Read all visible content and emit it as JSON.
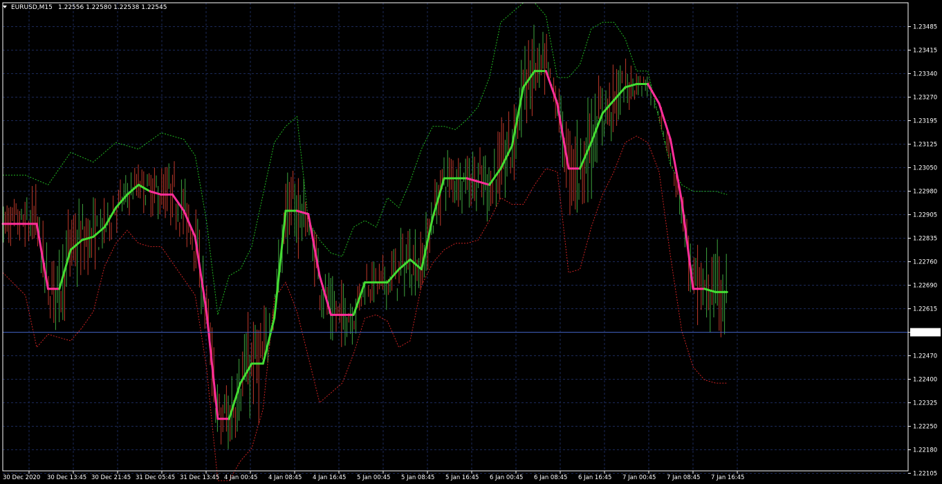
{
  "header": {
    "symbol_timeframe": "EURUSD,M15",
    "ohlc": "1.22556 1.22580 1.22538 1.22545"
  },
  "colors": {
    "background": "#000000",
    "grid": "#1c2a5a",
    "axis": "#ffffff",
    "candle_up": "#3fa63f",
    "candle_down": "#c0392b",
    "trend_up": "#44dd33",
    "trend_down": "#ff2e9a",
    "upper_band": "#22bb22",
    "lower_band": "#cc2222",
    "current_price_line": "#4060c0"
  },
  "chart_data": {
    "type": "line",
    "symbol": "EURUSD",
    "timeframe": "M15",
    "ylim": [
      1.2208,
      1.2352
    ],
    "y_ticks": [
      "1.23485",
      "1.23415",
      "1.23340",
      "1.23270",
      "1.23195",
      "1.23125",
      "1.23050",
      "1.22980",
      "1.22905",
      "1.22835",
      "1.22760",
      "1.22690",
      "1.22615",
      "1.22545",
      "1.22470",
      "1.22400",
      "1.22325",
      "1.22250",
      "1.22180",
      "1.22105"
    ],
    "current_price": "1.22545",
    "x_ticks": [
      "30 Dec 2020",
      "30 Dec 13:45",
      "30 Dec 21:45",
      "31 Dec 05:45",
      "31 Dec 13:45",
      "4 Jan 00:45",
      "4 Jan 08:45",
      "4 Jan 16:45",
      "5 Jan 00:45",
      "5 Jan 08:45",
      "5 Jan 16:45",
      "6 Jan 00:45",
      "6 Jan 08:45",
      "6 Jan 16:45",
      "7 Jan 00:45",
      "7 Jan 08:45",
      "7 Jan 16:45"
    ],
    "series": [
      {
        "key": "trend",
        "x": [
          0,
          3,
          4,
          5,
          6,
          7,
          8,
          9,
          10,
          11,
          12,
          13,
          14,
          15,
          16,
          17,
          18,
          19,
          20,
          21,
          22,
          23,
          24,
          25,
          26,
          27,
          28,
          29,
          30,
          31,
          32,
          33,
          34,
          35,
          36,
          37,
          38,
          39,
          40,
          41,
          42,
          43,
          44,
          45,
          46,
          47,
          48,
          49,
          50,
          51,
          52,
          53,
          54,
          55,
          56,
          57,
          58,
          59,
          60,
          61,
          62,
          63,
          64
        ],
        "values": [
          1.2284,
          1.2284,
          1.2264,
          1.2264,
          1.2276,
          1.2279,
          1.228,
          1.2283,
          1.2289,
          1.2293,
          1.2296,
          1.2294,
          1.2293,
          1.2293,
          1.2288,
          1.228,
          1.2257,
          1.2224,
          1.2224,
          1.2235,
          1.2241,
          1.2241,
          1.2255,
          1.2288,
          1.2288,
          1.2287,
          1.2268,
          1.2256,
          1.2256,
          1.2256,
          1.2266,
          1.2266,
          1.2266,
          1.227,
          1.2273,
          1.227,
          1.2286,
          1.2298,
          1.2298,
          1.2298,
          1.2297,
          1.2296,
          1.2301,
          1.2308,
          1.2326,
          1.2331,
          1.2331,
          1.2321,
          1.2301,
          1.2301,
          1.2309,
          1.2318,
          1.2322,
          1.2326,
          1.2327,
          1.2327,
          1.2321,
          1.231,
          1.2291,
          1.2264,
          1.2264,
          1.2263,
          1.2263
        ],
        "state": [
          "down",
          "down",
          "down",
          "up",
          "up",
          "up",
          "up",
          "up",
          "up",
          "up",
          "up",
          "down",
          "down",
          "down",
          "down",
          "down",
          "down",
          "down",
          "up",
          "up",
          "up",
          "up",
          "up",
          "up",
          "down",
          "down",
          "down",
          "down",
          "down",
          "up",
          "up",
          "up",
          "up",
          "up",
          "up",
          "up",
          "up",
          "up",
          "up",
          "down",
          "down",
          "up",
          "up",
          "up",
          "up",
          "up",
          "down",
          "down",
          "down",
          "up",
          "up",
          "up",
          "up",
          "up",
          "up",
          "down",
          "down",
          "down",
          "down",
          "down",
          "up",
          "up",
          "up"
        ]
      },
      {
        "key": "upper_band",
        "x": [
          0,
          2,
          4,
          6,
          8,
          10,
          12,
          14,
          16,
          17,
          18,
          19,
          20,
          21,
          22,
          23,
          24,
          25,
          26,
          27,
          28,
          29,
          30,
          31,
          32,
          33,
          34,
          35,
          36,
          37,
          38,
          39,
          40,
          41,
          42,
          43,
          44,
          45,
          46,
          47,
          48,
          49,
          50,
          51,
          52,
          53,
          54,
          55,
          56,
          57,
          58,
          59,
          60,
          61,
          62,
          63,
          64
        ],
        "values": [
          1.2299,
          1.2299,
          1.2296,
          1.2306,
          1.2303,
          1.2309,
          1.2307,
          1.2312,
          1.231,
          1.2305,
          1.2285,
          1.2256,
          1.2268,
          1.227,
          1.2277,
          1.2293,
          1.2309,
          1.2314,
          1.2317,
          1.2285,
          1.2279,
          1.2275,
          1.2274,
          1.2283,
          1.2285,
          1.2283,
          1.2292,
          1.2289,
          1.2297,
          1.2307,
          1.2314,
          1.2314,
          1.2313,
          1.2316,
          1.232,
          1.2329,
          1.2346,
          1.2349,
          1.2352,
          1.2352,
          1.2348,
          1.2329,
          1.2329,
          1.2333,
          1.2344,
          1.2346,
          1.2346,
          1.2341,
          1.2331,
          1.2331,
          1.2316,
          1.2302,
          1.2296,
          1.2294,
          1.2294,
          1.2294,
          1.2293
        ]
      },
      {
        "key": "lower_band",
        "x": [
          0,
          2,
          3,
          4,
          5,
          6,
          7,
          8,
          9,
          10,
          11,
          12,
          13,
          14,
          15,
          16,
          17,
          18,
          19,
          20,
          21,
          22,
          23,
          24,
          25,
          26,
          27,
          28,
          29,
          30,
          31,
          32,
          33,
          34,
          35,
          36,
          37,
          38,
          39,
          40,
          41,
          42,
          43,
          44,
          45,
          46,
          47,
          48,
          49,
          50,
          51,
          52,
          53,
          54,
          55,
          56,
          57,
          58,
          59,
          60,
          61,
          62,
          63,
          64
        ],
        "values": [
          1.2269,
          1.2262,
          1.2246,
          1.225,
          1.2249,
          1.2248,
          1.2252,
          1.2257,
          1.2271,
          1.2278,
          1.2282,
          1.2278,
          1.2277,
          1.2277,
          1.2272,
          1.2267,
          1.2262,
          1.224,
          1.2205,
          1.2205,
          1.2211,
          1.2215,
          1.2227,
          1.2261,
          1.2266,
          1.2257,
          1.2243,
          1.2229,
          1.2232,
          1.2235,
          1.2244,
          1.2255,
          1.2256,
          1.2254,
          1.2246,
          1.2248,
          1.2265,
          1.2272,
          1.2276,
          1.2278,
          1.2278,
          1.2279,
          1.2285,
          1.2292,
          1.229,
          1.229,
          1.2296,
          1.2301,
          1.23,
          1.2269,
          1.227,
          1.2283,
          1.2293,
          1.23,
          1.2309,
          1.2311,
          1.2309,
          1.23,
          1.2274,
          1.2251,
          1.224,
          1.2236,
          1.2235,
          1.2235
        ]
      }
    ]
  }
}
